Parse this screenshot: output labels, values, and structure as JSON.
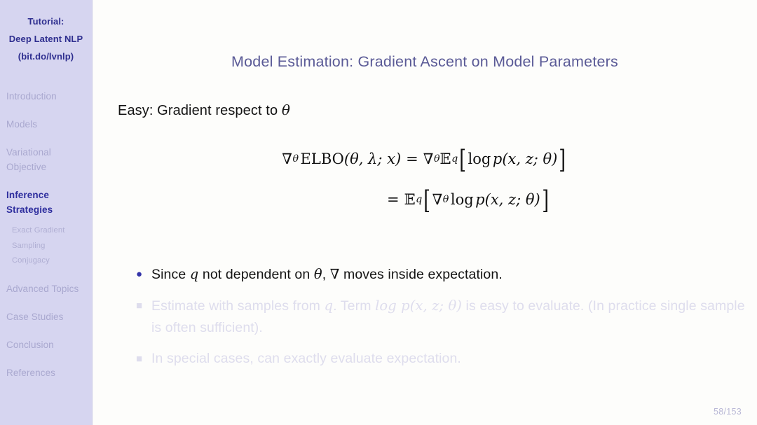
{
  "sidebar": {
    "header_lines": [
      "Tutorial:",
      "Deep Latent NLP",
      "(bit.do/lvnlp)"
    ],
    "sections": [
      {
        "label": "Introduction",
        "active": false
      },
      {
        "label": "Models",
        "active": false
      },
      {
        "label": "Variational Objective",
        "active": false
      },
      {
        "label": "Inference Strategies",
        "active": true
      },
      {
        "label": "Advanced Topics",
        "active": false
      },
      {
        "label": "Case Studies",
        "active": false
      },
      {
        "label": "Conclusion",
        "active": false
      },
      {
        "label": "References",
        "active": false
      }
    ],
    "subsections": [
      {
        "label": "Exact Gradient"
      },
      {
        "label": "Sampling"
      },
      {
        "label": "Conjugacy"
      }
    ]
  },
  "slide": {
    "title": "Model Estimation: Gradient Ascent on Model Parameters",
    "lead_text_prefix": "Easy: Gradient respect to ",
    "lead_text_symbol": "θ",
    "page_number": "58/153"
  },
  "equation": {
    "line1": {
      "lhs_nabla": "∇",
      "lhs_nabla_sub": "θ",
      "lhs_name": "ELBO",
      "lhs_args": "(θ, λ; x)",
      "relation": "=",
      "rhs_nabla": "∇",
      "rhs_nabla_sub": "θ",
      "rhs_E": "𝔼",
      "rhs_E_sub": "q",
      "bracket_open": "[",
      "rhs_body_log": "log",
      "rhs_body_p": "p",
      "rhs_body_args": "(x, z; θ)",
      "bracket_close": "]"
    },
    "line2": {
      "relation": "=",
      "E": "𝔼",
      "E_sub": "q",
      "bracket_open": "[",
      "nabla": "∇",
      "nabla_sub": "θ",
      "body_log": "log",
      "body_p": "p",
      "body_args": "(x, z; θ)",
      "bracket_close": "]"
    }
  },
  "bullets": [
    {
      "state": "active",
      "marker": "●",
      "part1": "Since ",
      "math1": "q",
      "part2": " not dependent on ",
      "math2": "θ",
      "part3": ", ",
      "math3": "∇",
      "part4": " moves inside expectation."
    },
    {
      "state": "dim",
      "marker": "■",
      "part1": "Estimate with samples from ",
      "math1": "q",
      "part2": ". Term ",
      "math2": "log p(x, z; θ)",
      "part3": " is easy to evaluate. (In practice single sample is often sufficient).",
      "math3": "",
      "part4": ""
    },
    {
      "state": "dim",
      "marker": "■",
      "part1": "In special cases, can exactly evaluate expectation.",
      "math1": "",
      "part2": "",
      "math2": "",
      "part3": "",
      "math3": "",
      "part4": ""
    }
  ]
}
